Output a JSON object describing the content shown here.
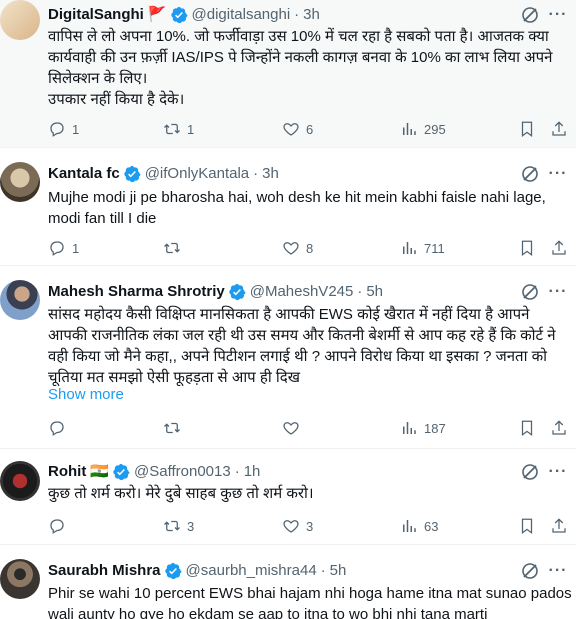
{
  "tweets": [
    {
      "name": "DigitalSanghi",
      "flag": "🚩",
      "handle": "@digitalsanghi",
      "time": "3h",
      "text": "वापिस ले लो अपना 10%. जो फर्जीवाड़ा उस 10% में चल रहा है सबको पता है। आजतक क्या कार्यवाही की उन फ़र्ज़ी IAS/IPS पे जिन्होंने नकली कागज़ बनवा के 10% का लाभ लिया अपने सिलेक्शन के लिए।\nउपकार नहीं किया है देके।",
      "replies": "1",
      "reposts": "1",
      "likes": "6",
      "views": "295"
    },
    {
      "name": "Kantala fc",
      "handle": "@ifOnlyKantala",
      "time": "3h",
      "text": "Mujhe modi ji pe bharosha hai, woh desh ke hit mein kabhi faisle nahi lage, modi fan till I die",
      "replies": "1",
      "reposts": "",
      "likes": "8",
      "views": "711"
    },
    {
      "name": "Mahesh Sharma Shrotriy",
      "handle": "@MaheshV245",
      "time": "5h",
      "text": "सांसद महोदय कैसी विक्षिप्त मानसिकता है आपकी EWS कोई खैरात में नहीं दिया है आपने आपकी राजनीतिक लंका जल रही थी उस समय और कितनी बेशर्मी से आप कह रहे हैं कि कोर्ट ने वही किया जो मैने कहा,, अपने पिटीशन लगाई थी ? आपने विरोध किया था इसका ? जनता को चूतिया मत समझो ऐसी फूहड़ता से आप ही दिख",
      "show_more": "Show more",
      "replies": "",
      "reposts": "",
      "likes": "",
      "views": "187"
    },
    {
      "name": "Rohit",
      "flag": "🇮🇳",
      "handle": "@Saffron0013",
      "time": "1h",
      "text": "कुछ तो शर्म करो। मेरे दुबे साहब कुछ तो शर्म करो।",
      "replies": "",
      "reposts": "3",
      "likes": "3",
      "views": "63"
    },
    {
      "name": "Saurabh Mishra",
      "handle": "@saurbh_mishra44",
      "time": "5h",
      "text": "Phir se wahi 10 percent EWS bhai hajam nhi hoga hame itna mat sunao pados wali aunty ho gye ho ekdam se aap to itna to wo bhi nhi tana marti"
    }
  ],
  "dot": "·",
  "more_glyph": "···",
  "colors": {
    "verified": "#1d9bf0",
    "muted": "#536471",
    "link": "#1d9bf0",
    "highlight_bg": "#f7f9f9",
    "border": "#eff3f4"
  },
  "icons": [
    "verified-badge-icon",
    "grok-icon",
    "more-icon",
    "reply-icon",
    "repost-icon",
    "like-icon",
    "views-icon",
    "bookmark-icon",
    "share-icon"
  ]
}
